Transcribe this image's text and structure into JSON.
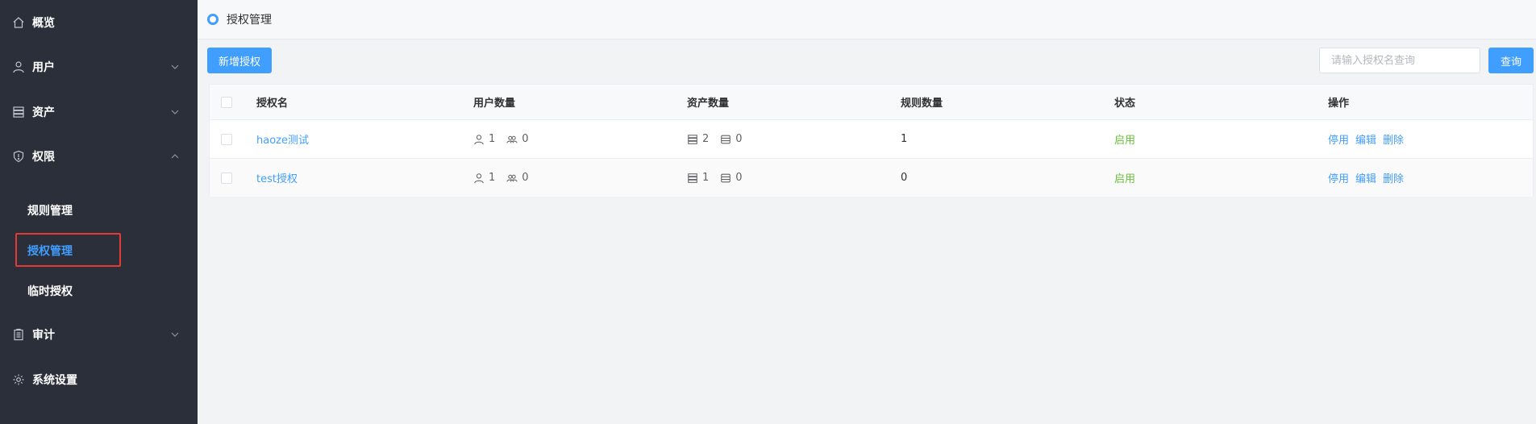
{
  "sidebar": {
    "items": [
      {
        "label": "概览",
        "icon": "home-icon"
      },
      {
        "label": "用户",
        "icon": "user-icon"
      },
      {
        "label": "资产",
        "icon": "server-icon"
      },
      {
        "label": "权限",
        "icon": "shield-icon"
      },
      {
        "label": "审计",
        "icon": "clipboard-icon"
      },
      {
        "label": "系统设置",
        "icon": "gear-icon"
      }
    ],
    "submenu": [
      {
        "label": "规则管理"
      },
      {
        "label": "授权管理"
      },
      {
        "label": "临时授权"
      }
    ]
  },
  "header": {
    "title": "授权管理"
  },
  "toolbar": {
    "add_label": "新增授权",
    "search_placeholder": "请输入授权名查询",
    "query_label": "查询"
  },
  "table": {
    "columns": [
      "授权名",
      "用户数量",
      "资产数量",
      "规则数量",
      "状态",
      "操作"
    ],
    "rows": [
      {
        "name": "haoze测试",
        "users": "1",
        "user_groups": "0",
        "assets": "2",
        "asset_groups": "0",
        "rules": "1",
        "status": "启用",
        "ops": [
          "停用",
          "编辑",
          "删除"
        ]
      },
      {
        "name": "test授权",
        "users": "1",
        "user_groups": "0",
        "assets": "1",
        "asset_groups": "0",
        "rules": "0",
        "status": "启用",
        "ops": [
          "停用",
          "编辑",
          "删除"
        ]
      }
    ]
  },
  "colors": {
    "sidebar_bg": "#2b2f3a",
    "accent": "#409eff",
    "status_enabled": "#67c23a",
    "highlight_border": "#e53935"
  }
}
